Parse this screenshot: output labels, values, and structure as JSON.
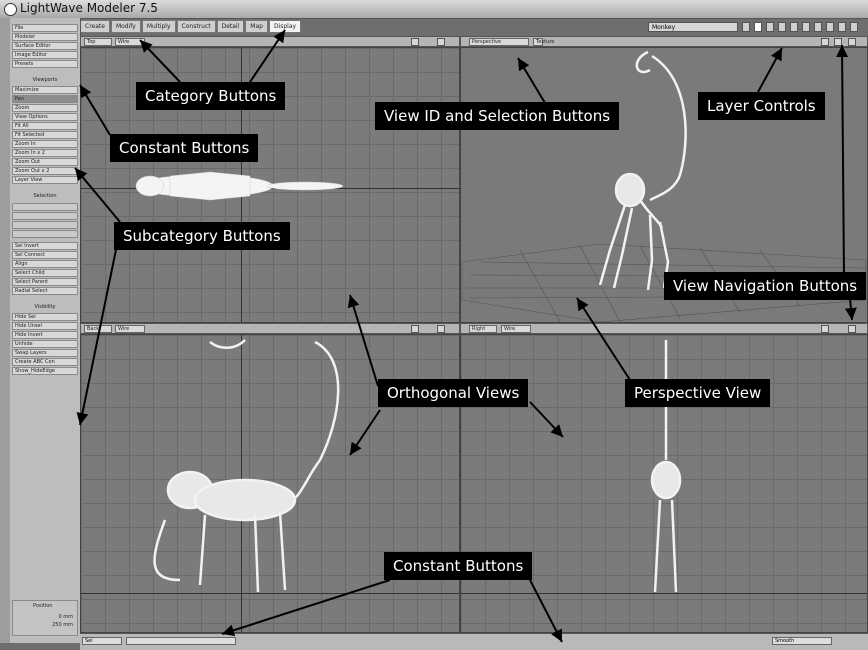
{
  "window": {
    "title": "LightWave Modeler 7.5"
  },
  "tabs": [
    {
      "label": "Create",
      "active": false
    },
    {
      "label": "Modify",
      "active": false
    },
    {
      "label": "Multiply",
      "active": false
    },
    {
      "label": "Construct",
      "active": false
    },
    {
      "label": "Detail",
      "active": false
    },
    {
      "label": "Map",
      "active": false
    },
    {
      "label": "Display",
      "active": true
    }
  ],
  "layers": {
    "object_name": "Monkey"
  },
  "sidebar": {
    "constant_buttons": [
      "File",
      "Modeler",
      "Surface Editor",
      "Image Editor",
      "Presets"
    ],
    "viewports_header": "Viewports",
    "view_buttons": [
      "Maximize",
      "Pan",
      "Zoom",
      "View Options",
      "Fit All",
      "Fit Selected",
      "Zoom In",
      "Zoom In x 2",
      "Zoom Out",
      "Zoom Out x 2",
      "Layer View"
    ],
    "selection_header": "Selection",
    "selection_buttons": [
      "Sel Invert",
      "Sel Connect",
      "Align",
      "Select Child",
      "Select Parent",
      "Radial Select"
    ],
    "visibility_header": "Visibility",
    "visibility_buttons": [
      "Hide Sel",
      "Hide Unsel",
      "Hide Invert",
      "Unhide",
      "Swap Layers",
      "Create ABC Con",
      "Show_HideEdge"
    ],
    "position": {
      "label": "Position",
      "line1": "0 mm",
      "line2": "250 mm"
    }
  },
  "viewports": [
    {
      "name": "Top",
      "mode": "Wire"
    },
    {
      "name": "Perspective",
      "mode": "Texture"
    },
    {
      "name": "Back",
      "mode": "Wire"
    },
    {
      "name": "Right",
      "mode": "Wire"
    }
  ],
  "statusbar": {
    "field1": "Sel",
    "field2": "",
    "right": "Smooth"
  },
  "callouts": {
    "category": "Category Buttons",
    "constant_top": "Constant Buttons",
    "view_id": "View ID and Selection Buttons",
    "layer": "Layer Controls",
    "subcategory": "Subcategory Buttons",
    "view_nav": "View Navigation Buttons",
    "orthogonal": "Orthogonal Views",
    "perspective": "Perspective View",
    "constant_bottom": "Constant Buttons"
  },
  "icons": [
    "app-icon",
    "pan-icon",
    "zoom-icon",
    "maximize-icon",
    "dropdown-arrow-icon"
  ]
}
